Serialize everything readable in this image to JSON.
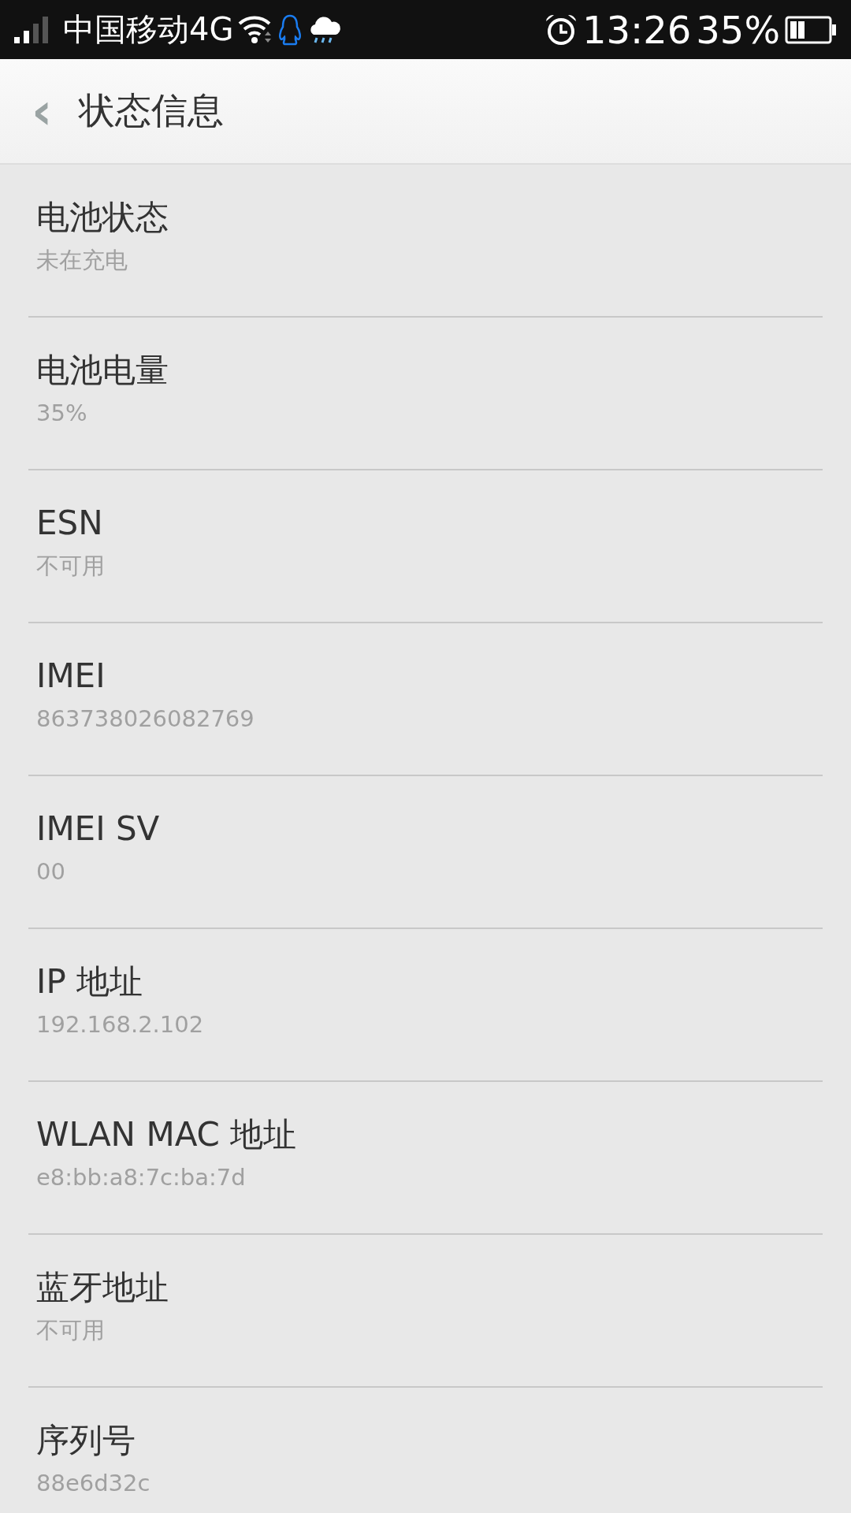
{
  "status_bar": {
    "carrier": "中国移动4G",
    "time": "13:26",
    "battery": "35%"
  },
  "header": {
    "back": "‹",
    "title": "状态信息"
  },
  "items": [
    {
      "label": "电池状态",
      "value": "未在充电"
    },
    {
      "label": "电池电量",
      "value": "35%"
    },
    {
      "label": "ESN",
      "value": "不可用"
    },
    {
      "label": "IMEI",
      "value": "863738026082769"
    },
    {
      "label": "IMEI SV",
      "value": "00"
    },
    {
      "label": "IP 地址",
      "value": "192.168.2.102"
    },
    {
      "label": "WLAN MAC 地址",
      "value": "e8:bb:a8:7c:ba:7d"
    },
    {
      "label": "蓝牙地址",
      "value": "不可用"
    },
    {
      "label": "序列号",
      "value": "88e6d32c"
    }
  ]
}
